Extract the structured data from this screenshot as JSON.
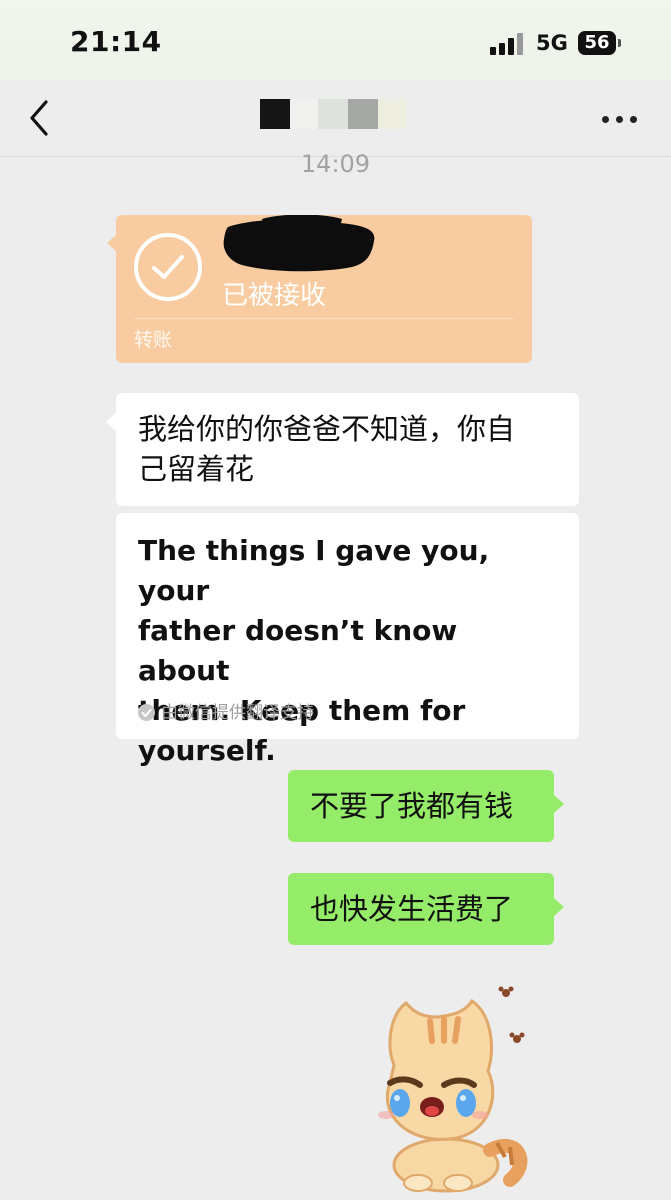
{
  "status_bar": {
    "time": "21:14",
    "network": "5G",
    "battery": "56"
  },
  "nav": {
    "back_icon": "chevron-left-icon",
    "more_icon": "more-dots-icon"
  },
  "chat": {
    "timestamp": "14:09",
    "transfer": {
      "status": "已被接收",
      "label": "转账",
      "icon": "check-circle-icon",
      "color": "#f8cca0"
    },
    "incoming_message": {
      "line1": "我给你的你爸爸不知道，你自",
      "line2": "己留着花"
    },
    "translation": {
      "line1": "The things I gave you, your",
      "line2": "father doesn’t know about",
      "line3": "them. Keep them for",
      "line4": "yourself.",
      "provider": "由微信提供翻译支持"
    },
    "outgoing_messages": [
      {
        "text": "不要了我都有钱"
      },
      {
        "text": "也快发生活费了"
      }
    ],
    "sticker": "crying-cat-sticker"
  },
  "colors": {
    "background": "#ededed",
    "outgoing_bubble": "#95ec69",
    "incoming_bubble": "#ffffff",
    "transfer_card": "#f8cca0"
  }
}
